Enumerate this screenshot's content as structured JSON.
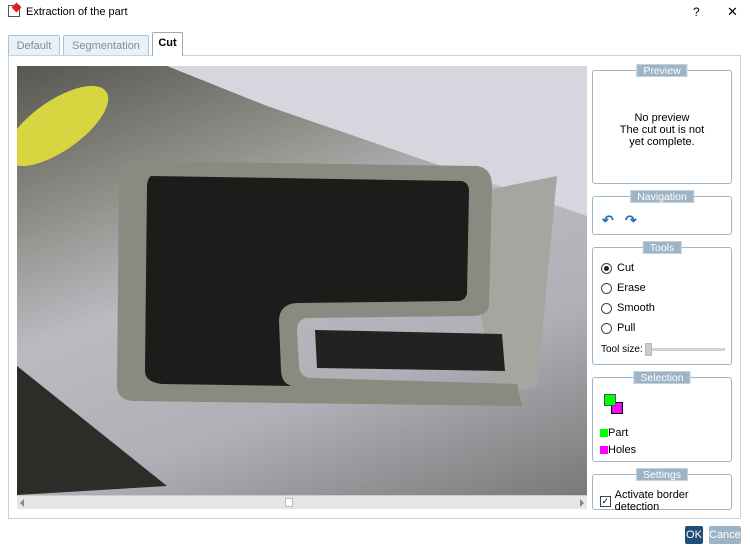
{
  "window": {
    "title": "Extraction of the part",
    "help": "?",
    "close": "✕"
  },
  "tabs": [
    {
      "label": "Default"
    },
    {
      "label": "Segmentation"
    },
    {
      "label": "Cut"
    }
  ],
  "preview": {
    "title": "Preview",
    "line1": "No preview",
    "line2": "The cut out is not yet complete."
  },
  "navigation": {
    "title": "Navigation",
    "undo": "undo-icon",
    "redo": "redo-icon"
  },
  "tools": {
    "title": "Tools",
    "options": [
      "Cut",
      "Erase",
      "Smooth",
      "Pull"
    ],
    "selected": "Cut",
    "tool_size_label": "Tool size:",
    "tool_size": 0
  },
  "selection": {
    "title": "Selection",
    "part": "Part",
    "holes": "Holes",
    "part_color": "#00ff00",
    "holes_color": "#ff00ff"
  },
  "settings": {
    "title": "Settings",
    "border_detection": "Activate border detection",
    "border_detection_checked": true
  },
  "buttons": {
    "ok": "OK",
    "cancel": "Cancel"
  },
  "scroll": {
    "horizontal_position": 0.47
  }
}
